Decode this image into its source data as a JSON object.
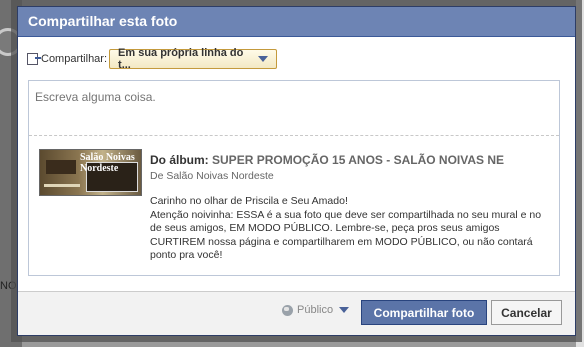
{
  "dialog": {
    "title": "Compartilhar esta foto",
    "share_label": "Compartilhar:",
    "share_target": "Em sua própria linha do t...",
    "compose_placeholder": "Escreva alguma coisa.",
    "preview": {
      "album_prefix": "Do álbum:",
      "album_name": "SUPER PROMOÇÃO 15 ANOS - SALÃO NOIVAS NE",
      "album_source": "De Salão Noivas Nordeste",
      "thumb_text": "Salão Noivas Nordeste",
      "caption_line1": "Carinho no olhar de Priscila e Seu Amado!",
      "caption_body": "Atenção noivinha: ESSA é a sua foto que deve ser compartilhada no seu mural e no de seus amigos, EM MODO PÚBLICO. Lembre-se, peça pros seus amigos CURTIREM nossa página e compartilharem em MODO PÚBLICO, ou não contará ponto pra você!"
    },
    "footer": {
      "privacy_label": "Público",
      "share_button": "Compartilhar foto",
      "cancel_button": "Cancelar"
    }
  },
  "background": {
    "fragment": "NO"
  },
  "colors": {
    "title_bar": "#6d84b4",
    "primary_button": "#5b74a8",
    "link": "#3b5998"
  }
}
